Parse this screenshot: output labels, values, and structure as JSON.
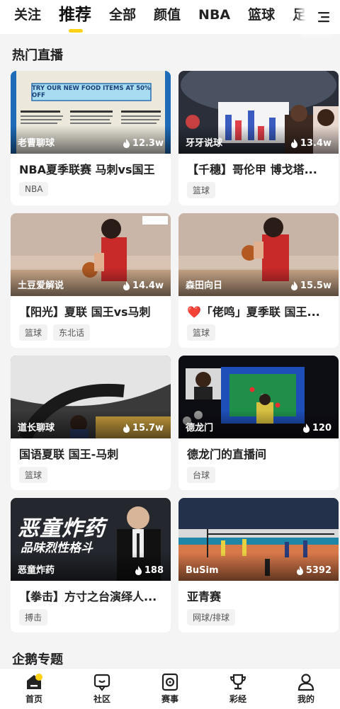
{
  "nav": {
    "tabs": [
      "关注",
      "推荐",
      "全部",
      "颜值",
      "NBA",
      "篮球",
      "足球"
    ],
    "active_tab": "推荐"
  },
  "section_hot": "热门直播",
  "section_topic": "企鹅专题",
  "cards": [
    {
      "streamer": "老曹聊球",
      "viewers": "12.3w",
      "title": "NBA夏季联赛 马刺vs国王",
      "tags": [
        "NBA"
      ],
      "overlay_text": "TRY OUR NEW FOOD ITEMS AT 50% OFF"
    },
    {
      "streamer": "牙牙说球",
      "viewers": "13.4w",
      "title": "【千穗】哥伦甲 博戈塔...",
      "tags": [
        "篮球"
      ]
    },
    {
      "streamer": "土豆爱解说",
      "viewers": "14.4w",
      "title": "【阳光】夏联 国王vs马刺",
      "tags": [
        "篮球",
        "东北话"
      ]
    },
    {
      "streamer": "森田向日",
      "viewers": "15.5w",
      "title": "「佬鸣」夏季联 国王...",
      "title_prefix": "❤️",
      "tags": [
        "篮球"
      ]
    },
    {
      "streamer": "道长聊球",
      "viewers": "15.7w",
      "title": "国语夏联 国王-马刺",
      "tags": [
        "篮球"
      ]
    },
    {
      "streamer": "德龙门",
      "viewers": "120",
      "title": "德龙门的直播间",
      "tags": [
        "台球"
      ]
    },
    {
      "streamer": "恶童炸药",
      "viewers": "188",
      "title": "【拳击】方寸之台演绎人...",
      "tags": [
        "搏击"
      ],
      "overlay_text": "恶童炸药",
      "overlay_sub": "品味烈性格斗"
    },
    {
      "streamer": "BuSim",
      "viewers": "5392",
      "title": "亚青赛",
      "tags": [
        "网球/排球"
      ]
    }
  ],
  "bottom_nav": [
    {
      "label": "首页",
      "icon": "home-icon",
      "active": true
    },
    {
      "label": "社区",
      "icon": "community-icon"
    },
    {
      "label": "赛事",
      "icon": "match-icon"
    },
    {
      "label": "彩经",
      "icon": "trophy-icon"
    },
    {
      "label": "我的",
      "icon": "profile-icon"
    }
  ],
  "colors": {
    "accent": "#ffd21a",
    "background": "#f4f4f4"
  }
}
